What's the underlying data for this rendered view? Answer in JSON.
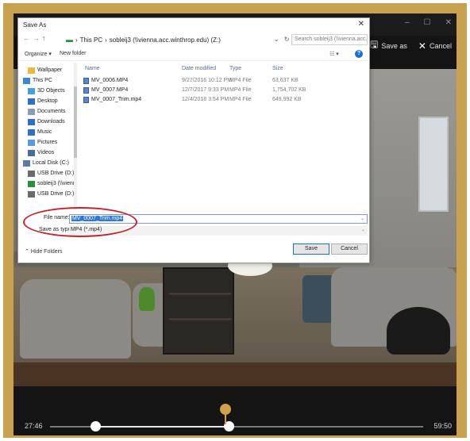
{
  "app": {
    "window_controls": [
      "–",
      "☐",
      "✕"
    ],
    "save_as_label": "Save as",
    "cancel_label": "Cancel",
    "save_icon": "save-icon",
    "cancel_icon": "close-icon"
  },
  "timeline": {
    "start_time": "27:46",
    "end_time": "59:50",
    "accent_color": "#d2a14a"
  },
  "dialog": {
    "title": "Save As",
    "close_glyph": "✕",
    "address": {
      "back": "←",
      "forward": "→",
      "up": "↑",
      "path_pc": "This PC",
      "sep": "›",
      "path_drive": "sobleij3 (\\\\vienna.acc.winthrop.edu) (Z:)",
      "refresh_glyph": "↻",
      "dropdown_glyph": "⌄",
      "search_placeholder": "Search sobleij3 (\\\\vienna.acc..."
    },
    "toolbar": {
      "organize": "Organize ▾",
      "new_folder": "New folder",
      "view": "☷ ▾",
      "help": "?"
    },
    "nav_items": [
      {
        "label": "Wallpaper",
        "icon": "folder-icon",
        "color": "#e9b93a"
      },
      {
        "label": "This PC",
        "icon": "computer-icon",
        "color": "#3a86d0"
      },
      {
        "label": "3D Objects",
        "icon": "cube-icon",
        "color": "#46a0d9"
      },
      {
        "label": "Desktop",
        "icon": "desktop-icon",
        "color": "#2f6fc4"
      },
      {
        "label": "Documents",
        "icon": "document-icon",
        "color": "#8a9bb3"
      },
      {
        "label": "Downloads",
        "icon": "download-icon",
        "color": "#2f6fc4"
      },
      {
        "label": "Music",
        "icon": "music-icon",
        "color": "#2f6fc4"
      },
      {
        "label": "Pictures",
        "icon": "picture-icon",
        "color": "#5a9ad8"
      },
      {
        "label": "Videos",
        "icon": "video-icon",
        "color": "#4a6a9a"
      },
      {
        "label": "Local Disk (C:)",
        "icon": "disk-icon",
        "color": "#5a7aa8"
      },
      {
        "label": "USB Drive (D:)",
        "icon": "usb-icon",
        "color": "#6a6a6a"
      },
      {
        "label": "sobleij3 (\\\\vienn",
        "icon": "network-drive-icon",
        "color": "#2a8e3e"
      },
      {
        "label": "USB Drive (D:)",
        "icon": "usb-icon",
        "color": "#6a6a6a"
      }
    ],
    "columns": {
      "name": "Name",
      "date": "Date modified",
      "type": "Type",
      "size": "Size"
    },
    "files": [
      {
        "name": "MV_0006.MP4",
        "date": "9/27/2016 10:12 PM",
        "type": "MP4 File",
        "size": "63,637 KB"
      },
      {
        "name": "MV_0007.MP4",
        "date": "12/7/2017 9:33 PM",
        "type": "MP4 File",
        "size": "1,754,702 KB"
      },
      {
        "name": "MV_0007_Trim.mp4",
        "date": "12/4/2018 3:54 PM",
        "type": "MP4 File",
        "size": "649,992 KB"
      }
    ],
    "file_name_label": "File name:",
    "file_name_value": "MV_0007_Trim.mp4",
    "save_type_label": "Save as type:",
    "save_type_value": "MP4 (*.mp4)",
    "hide_folders": "Hide Folders",
    "save_button": "Save",
    "cancel_button": "Cancel",
    "annotation_color": "#c3232a"
  }
}
